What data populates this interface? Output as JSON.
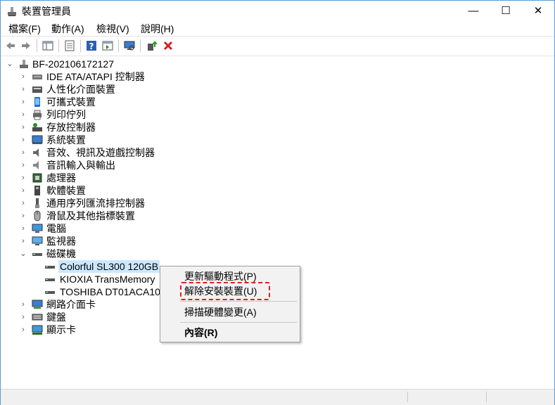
{
  "window": {
    "title": "裝置管理員",
    "controls": {
      "minimize": "—",
      "maximize": "☐",
      "close": "✕"
    }
  },
  "menu": [
    "檔案(F)",
    "動作(A)",
    "檢視(V)",
    "說明(H)"
  ],
  "toolbar": {
    "buttons": [
      "back-icon",
      "forward-icon",
      "show-hide-console-tree-icon",
      "properties-icon",
      "help-icon",
      "action-pane-icon",
      "scan-hardware-icon",
      "update-driver-icon",
      "uninstall-device-icon"
    ]
  },
  "tree": {
    "root": "BF-202106172127",
    "categories": [
      {
        "label": "IDE ATA/ATAPI 控制器",
        "icon": "ide-controller-icon"
      },
      {
        "label": "人性化介面裝置",
        "icon": "hid-icon"
      },
      {
        "label": "可攜式裝置",
        "icon": "portable-device-icon"
      },
      {
        "label": "列印佇列",
        "icon": "printer-icon"
      },
      {
        "label": "存放控制器",
        "icon": "storage-controller-icon"
      },
      {
        "label": "系統裝置",
        "icon": "system-device-icon"
      },
      {
        "label": "音效、視訊及遊戲控制器",
        "icon": "speaker-icon"
      },
      {
        "label": "音訊輸入與輸出",
        "icon": "audio-io-icon"
      },
      {
        "label": "處理器",
        "icon": "processor-icon"
      },
      {
        "label": "軟體裝置",
        "icon": "software-device-icon"
      },
      {
        "label": "通用序列匯流排控制器",
        "icon": "usb-icon"
      },
      {
        "label": "滑鼠及其他指標裝置",
        "icon": "mouse-icon"
      },
      {
        "label": "電腦",
        "icon": "computer-icon"
      },
      {
        "label": "監視器",
        "icon": "monitor-icon"
      }
    ],
    "disk_category": {
      "label": "磁碟機",
      "expanded": true,
      "children": [
        {
          "label": "Colorful SL300 120GB",
          "selected": true
        },
        {
          "label": "KIOXIA TransMemory"
        },
        {
          "label": "TOSHIBA DT01ACA10"
        }
      ]
    },
    "after_categories": [
      {
        "label": "網路介面卡",
        "icon": "network-adapter-icon"
      },
      {
        "label": "鍵盤",
        "icon": "keyboard-icon"
      },
      {
        "label": "顯示卡",
        "icon": "display-adapter-icon"
      }
    ]
  },
  "context_menu": {
    "items": [
      "更新驅動程式(P)",
      "解除安裝裝置(U)",
      "掃描硬體變更(A)",
      "內容(R)"
    ],
    "highlighted": "解除安裝裝置(U)"
  },
  "colors": {
    "selection": "#cce8ff",
    "highlight_outline": "#e02020",
    "uninstall_x": "#d32020",
    "window_border": "#5a9bd8"
  }
}
